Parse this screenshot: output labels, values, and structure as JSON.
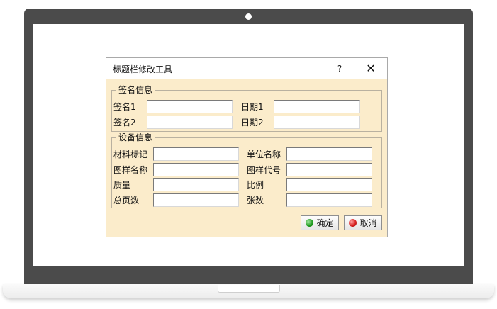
{
  "dialog": {
    "title": "标题栏修改工具",
    "help": "?",
    "close": "✕"
  },
  "signature_group": {
    "title": "签名信息",
    "fields": [
      {
        "label": "签名1",
        "value": ""
      },
      {
        "label": "日期1",
        "value": ""
      },
      {
        "label": "签名2",
        "value": ""
      },
      {
        "label": "日期2",
        "value": ""
      }
    ]
  },
  "device_group": {
    "title": "设备信息",
    "fields": [
      {
        "label": "材料标记",
        "value": ""
      },
      {
        "label": "单位名称",
        "value": ""
      },
      {
        "label": "图样名称",
        "value": ""
      },
      {
        "label": "图样代号",
        "value": ""
      },
      {
        "label": "质量",
        "value": ""
      },
      {
        "label": "比例",
        "value": ""
      },
      {
        "label": "总页数",
        "value": ""
      },
      {
        "label": "张数",
        "value": ""
      }
    ]
  },
  "buttons": {
    "ok": "确定",
    "cancel": "取消"
  },
  "colors": {
    "dialog_bg": "#fbeccb",
    "bezel": "#4b4b4b"
  }
}
